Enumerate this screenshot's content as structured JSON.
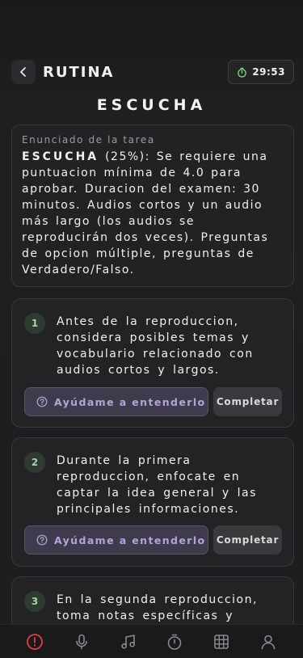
{
  "header": {
    "title": "RUTINA",
    "back_icon": "chevron-left-icon",
    "timer": "29:53",
    "timer_icon": "stopwatch-icon"
  },
  "section": {
    "title": "ESCUCHA"
  },
  "task": {
    "label": "Enunciado de la tarea",
    "bold_prefix": "ESCUCHA",
    "text": " (25%): Se requiere una puntuacion mínima de 4.0 para aprobar. Duracion del examen: 30 minutos. Audios cortos y un audio más largo (los audios se reproducirán dos veces). Preguntas de opcion múltiple, preguntas de Verdadero/Falso."
  },
  "steps": [
    {
      "number": "1",
      "text": "Antes de la reproduccion, considera posibles temas y vocabulario relacionado con audios cortos y largos.",
      "help_label": "Ayúdame a entenderlo",
      "complete_label": "Completar"
    },
    {
      "number": "2",
      "text": "Durante la primera reproduccion, enfocate en captar la idea general y las principales informaciones.",
      "help_label": "Ayúdame a entenderlo",
      "complete_label": "Completar"
    },
    {
      "number": "3",
      "text": "En la segunda reproduccion, toma notas específicas y"
    }
  ],
  "bottom_nav": [
    {
      "icon": "alert-circle-icon",
      "active": true
    },
    {
      "icon": "microphone-icon",
      "active": false
    },
    {
      "icon": "music-note-icon",
      "active": false
    },
    {
      "icon": "stopwatch-icon",
      "active": false
    },
    {
      "icon": "grid-icon",
      "active": false
    },
    {
      "icon": "user-icon",
      "active": false
    }
  ],
  "colors": {
    "background": "#1e1d20",
    "accent_purple": "#b3a4d6",
    "active_red": "#e0403c",
    "step_green": "#a9d3ad"
  }
}
